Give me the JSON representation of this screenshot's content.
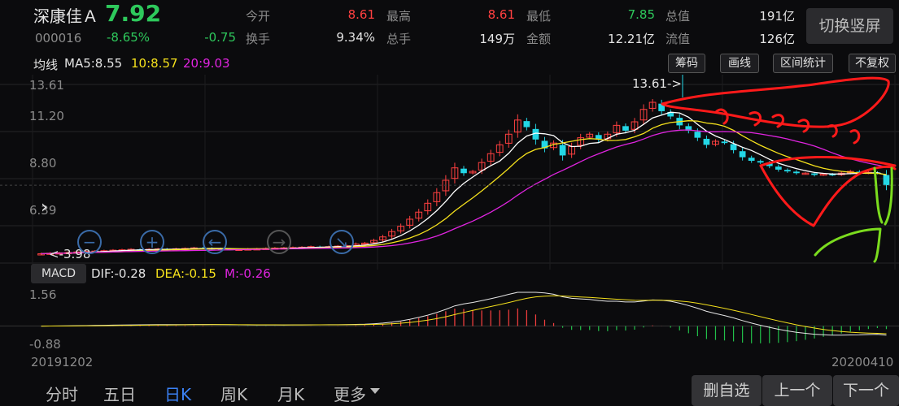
{
  "stock": {
    "name": "深康佳Ａ",
    "code": "000016",
    "price": "7.92",
    "pct_change": "-8.65%",
    "change": "-0.75"
  },
  "quote": {
    "open_label": "今开",
    "open_value": "8.61",
    "turnover_label": "换手",
    "turnover_value": "9.34%",
    "high_label": "最高",
    "high_value": "8.61",
    "volume_label": "总手",
    "volume_value": "149万",
    "low_label": "最低",
    "low_value": "7.85",
    "amount_label": "金额",
    "amount_value": "12.21亿",
    "mcap_label": "总值",
    "mcap_value": "191亿",
    "float_label": "流值",
    "float_value": "126亿"
  },
  "switch_button": "切换竖屏",
  "ma": {
    "label": "均线",
    "ma5": "MA5:8.55",
    "ma10": "10:8.57",
    "ma20": "20:9.03"
  },
  "toolbar": {
    "chips": "筹码",
    "draw": "画线",
    "range_stats": "区间统计",
    "no_adjust": "不复权"
  },
  "y_axis": [
    "13.61",
    "11.20",
    "8.80",
    "6.39",
    "3.98"
  ],
  "annotations": {
    "high_marker": "13.61->",
    "low_marker": "<-3.98"
  },
  "macd": {
    "button": "MACD",
    "dif": "DIF:-0.28",
    "dea": "DEA:-0.15",
    "m": "M:-0.26",
    "y_top": "1.56",
    "y_bottom": "-0.88"
  },
  "dates": {
    "start": "20191202",
    "end": "20200410"
  },
  "periods": [
    "分时",
    "五日",
    "日K",
    "周K",
    "月K",
    "更多"
  ],
  "active_period": "日K",
  "actions": {
    "remove_watchlist": "删自选",
    "prev": "上一个",
    "next": "下一个"
  },
  "colors": {
    "up": "#ff4040",
    "down": "#23d7e6",
    "ma5": "#ffffff",
    "ma10": "#f5e11c",
    "ma20": "#e024e0",
    "price_down": "#2ec95c"
  },
  "chart_data": {
    "type": "candlestick",
    "ylim": [
      3.98,
      13.61
    ],
    "closes": [
      4.05,
      4.08,
      4.1,
      4.12,
      4.15,
      4.18,
      4.2,
      4.22,
      4.25,
      4.27,
      4.3,
      4.28,
      4.3,
      4.32,
      4.3,
      4.33,
      4.35,
      4.38,
      4.36,
      4.34,
      4.32,
      4.3,
      4.3,
      4.32,
      4.33,
      4.35,
      4.37,
      4.38,
      4.4,
      4.42,
      4.45,
      4.43,
      4.45,
      4.48,
      4.5,
      4.6,
      4.65,
      4.8,
      5.0,
      5.3,
      5.6,
      6.0,
      6.4,
      6.9,
      7.5,
      8.2,
      8.9,
      8.6,
      8.7,
      9.2,
      9.7,
      10.2,
      10.8,
      11.6,
      11.2,
      10.5,
      10.0,
      10.3,
      9.6,
      10.1,
      10.6,
      10.8,
      10.5,
      10.8,
      11.3,
      11.0,
      11.5,
      12.2,
      12.6,
      12.1,
      11.8,
      11.3,
      11.0,
      10.6,
      10.2,
      10.4,
      10.3,
      9.9,
      9.5,
      9.3,
      9.2,
      9.0,
      8.8,
      8.7,
      8.6,
      8.6,
      8.5,
      8.55,
      8.5,
      8.6,
      8.7,
      8.6,
      8.65,
      8.6,
      7.92
    ],
    "ma5_last": 8.55,
    "ma10_last": 8.57,
    "ma20_last": 9.03,
    "macd_range": [
      -0.88,
      1.56
    ]
  }
}
